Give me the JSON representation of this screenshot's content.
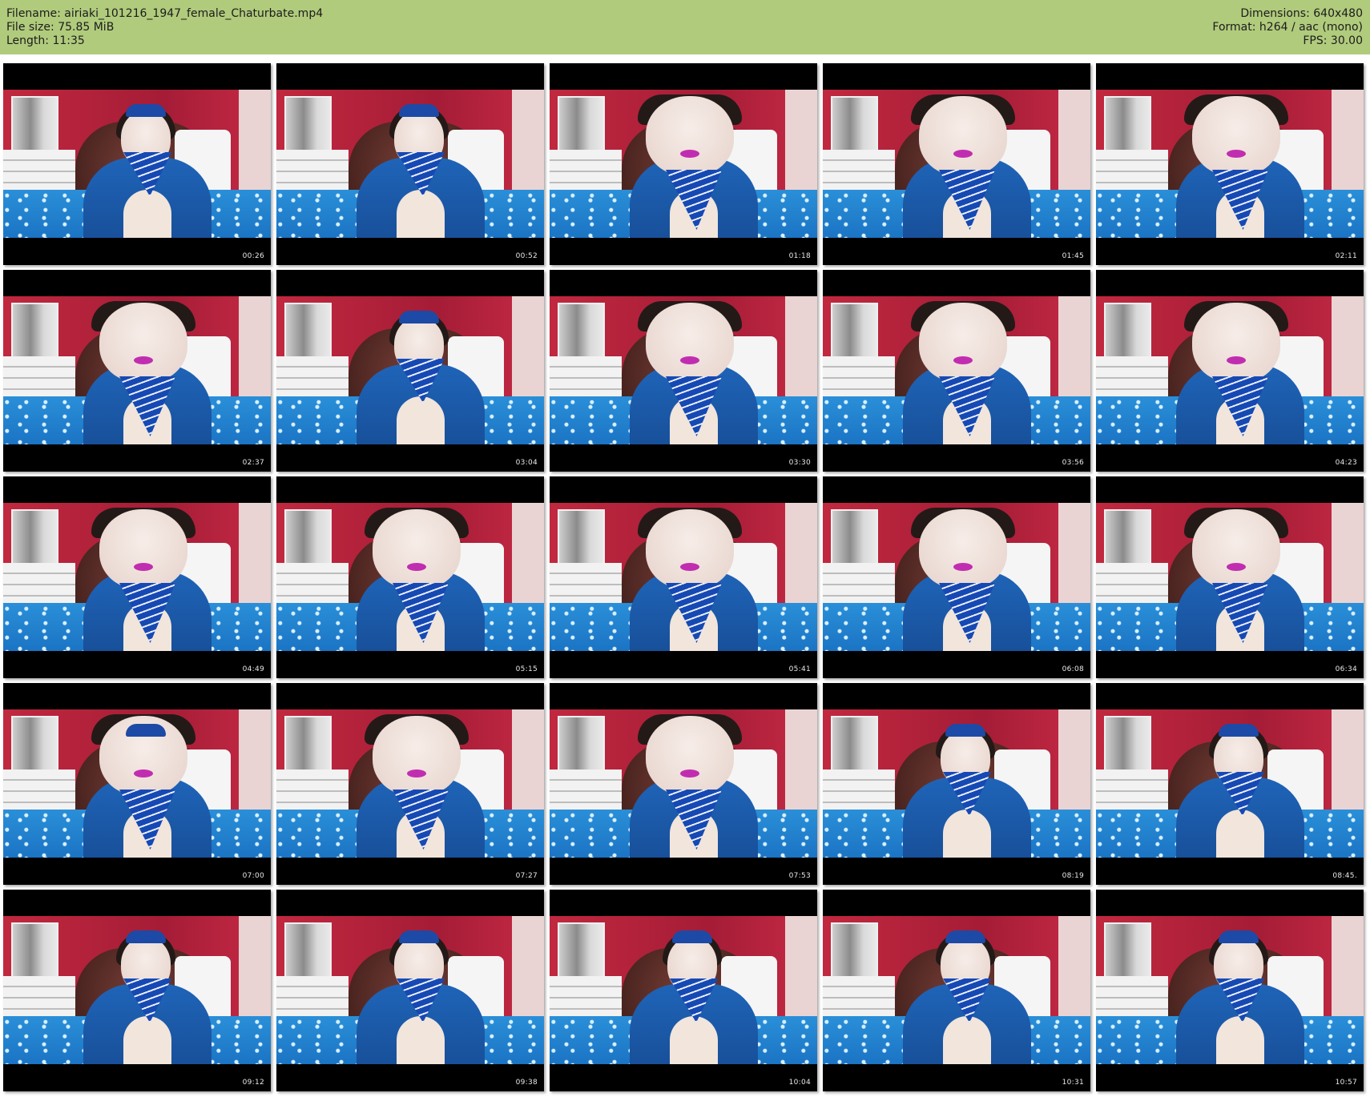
{
  "header": {
    "filename": "Filename: airiaki_101216_1947_female_Chaturbate.mp4",
    "filesize": "File size: 75.85 MiB",
    "length": "Length: 11:35",
    "dimensions": "Dimensions: 640x480",
    "format": "Format: h264 / aac (mono)",
    "fps": "FPS: 30.00"
  },
  "thumbnails": [
    {
      "timestamp": "00:26",
      "hat": true,
      "close": false
    },
    {
      "timestamp": "00:52",
      "hat": true,
      "close": false
    },
    {
      "timestamp": "01:18",
      "hat": false,
      "close": true
    },
    {
      "timestamp": "01:45",
      "hat": false,
      "close": true
    },
    {
      "timestamp": "02:11",
      "hat": false,
      "close": true
    },
    {
      "timestamp": "02:37",
      "hat": false,
      "close": true
    },
    {
      "timestamp": "03:04",
      "hat": true,
      "close": false
    },
    {
      "timestamp": "03:30",
      "hat": false,
      "close": true
    },
    {
      "timestamp": "03:56",
      "hat": false,
      "close": true
    },
    {
      "timestamp": "04:23",
      "hat": false,
      "close": true
    },
    {
      "timestamp": "04:49",
      "hat": false,
      "close": true
    },
    {
      "timestamp": "05:15",
      "hat": false,
      "close": true
    },
    {
      "timestamp": "05:41",
      "hat": false,
      "close": true
    },
    {
      "timestamp": "06:08",
      "hat": false,
      "close": true
    },
    {
      "timestamp": "06:34",
      "hat": false,
      "close": true
    },
    {
      "timestamp": "07:00",
      "hat": true,
      "close": true
    },
    {
      "timestamp": "07:27",
      "hat": false,
      "close": true
    },
    {
      "timestamp": "07:53",
      "hat": false,
      "close": true
    },
    {
      "timestamp": "08:19",
      "hat": true,
      "close": false
    },
    {
      "timestamp": "08:45.",
      "hat": true,
      "close": false
    },
    {
      "timestamp": "09:12",
      "hat": true,
      "close": false
    },
    {
      "timestamp": "09:38",
      "hat": true,
      "close": false
    },
    {
      "timestamp": "10:04",
      "hat": true,
      "close": false
    },
    {
      "timestamp": "10:31",
      "hat": true,
      "close": false
    },
    {
      "timestamp": "10:57",
      "hat": true,
      "close": false
    }
  ]
}
